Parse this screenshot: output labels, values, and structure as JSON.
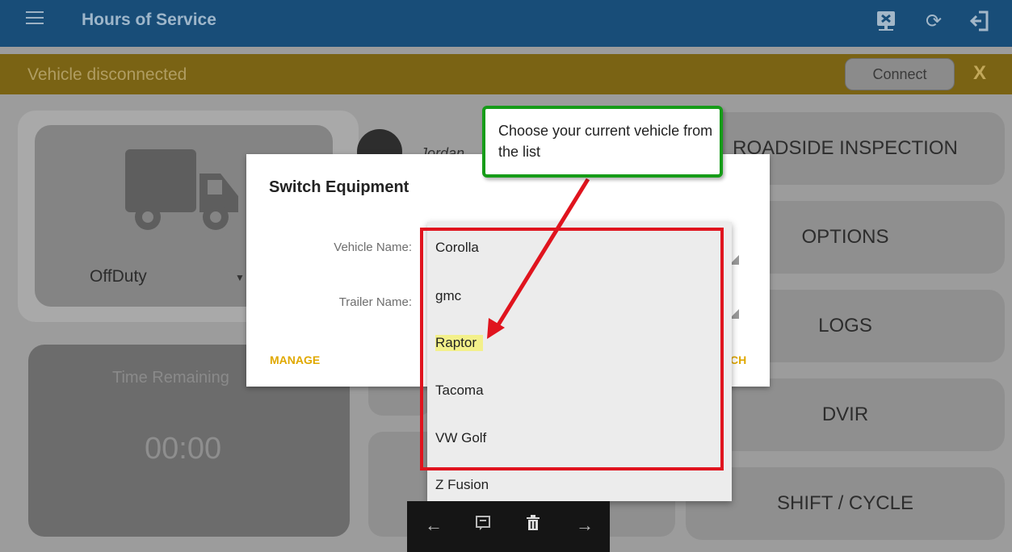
{
  "appbar": {
    "title": "Hours of Service",
    "icons": [
      "menu-icon",
      "device-disconnect-icon",
      "refresh-icon",
      "logout-icon"
    ]
  },
  "banner": {
    "message": "Vehicle disconnected",
    "connect_label": "Connect",
    "close_label": "X"
  },
  "status": {
    "current": "OffDuty",
    "time_label": "Time Remaining",
    "time_value": "00:00"
  },
  "driver": {
    "name": "Jordan"
  },
  "right_menu": [
    {
      "label": "ROADSIDE INSPECTION"
    },
    {
      "label": "OPTIONS"
    },
    {
      "label": "LOGS"
    },
    {
      "label": "DVIR"
    },
    {
      "label": "SHIFT / CYCLE"
    }
  ],
  "dialog": {
    "title": "Switch Equipment",
    "vehicle_label": "Vehicle Name:",
    "trailer_label": "Trailer Name:",
    "manage_label": "MANAGE",
    "switch_label": "CH"
  },
  "dropdown": {
    "options": [
      "Corolla",
      "gmc",
      "Raptor",
      "Tacoma",
      "VW Golf",
      "Z Fusion"
    ],
    "highlighted": "Raptor"
  },
  "callout": {
    "text": "Choose your current vehicle from the list"
  },
  "colors": {
    "appbar": "#184d78",
    "banner": "#7a6314",
    "callout_border": "#169c18",
    "annotation_red": "#e0141e",
    "accent": "#e0a800"
  }
}
